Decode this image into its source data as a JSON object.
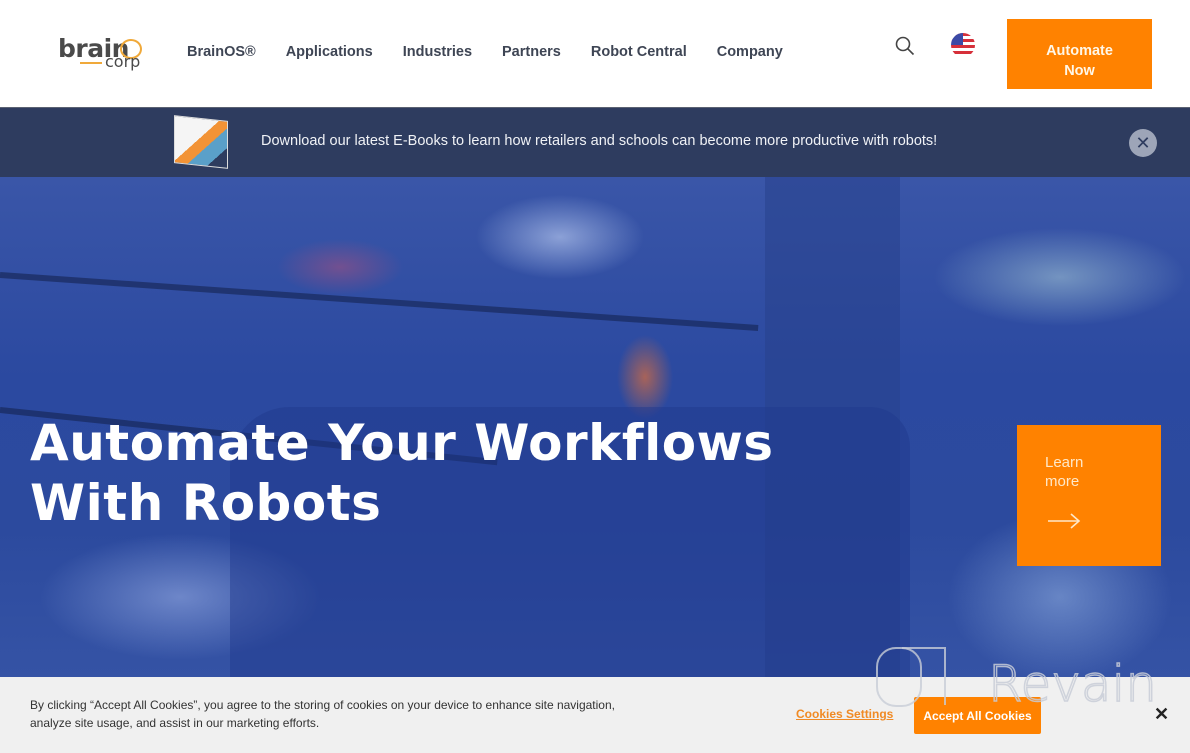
{
  "header": {
    "logo": {
      "brain": "brain",
      "corp": "corp"
    },
    "nav": [
      "BrainOS®",
      "Applications",
      "Industries",
      "Partners",
      "Robot Central",
      "Company"
    ],
    "cta_label": "Automate\nNow",
    "cta_line1": "Automate",
    "cta_line2": "Now"
  },
  "banner": {
    "text": "Download our latest E-Books to learn how retailers and schools can become more productive with robots!",
    "close_glyph": "✕"
  },
  "hero": {
    "title": "Automate Your Workflows With Robots",
    "learn_more_label": "Learn more"
  },
  "cookie": {
    "text": "By clicking “Accept All Cookies”, you agree to the storing of cookies on your device to enhance site navigation, analyze site usage, and assist in our marketing efforts.",
    "settings_label": "Cookies Settings",
    "accept_label": "Accept All Cookies",
    "close_glyph": "✕"
  },
  "watermark": {
    "text": "Revain"
  },
  "colors": {
    "accent": "#ff8200",
    "banner": "#2e3c5f",
    "nav_text": "#3e4554",
    "cookie_bg": "#f0f0f0"
  }
}
